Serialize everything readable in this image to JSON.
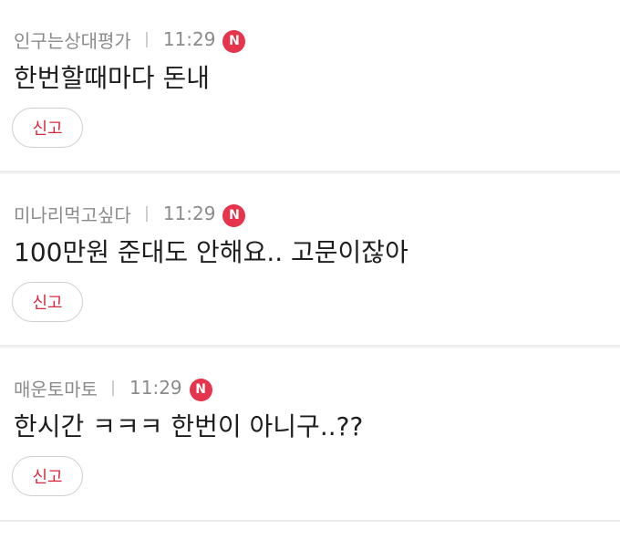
{
  "comments": [
    {
      "nickname": "인구는상대평가",
      "time": "11:29",
      "badge": "N",
      "text": "한번할때마다 돈내",
      "report_label": "신고"
    },
    {
      "nickname": "미나리먹고싶다",
      "time": "11:29",
      "badge": "N",
      "text": "100만원 준대도 안해요.. 고문이잖아",
      "report_label": "신고"
    },
    {
      "nickname": "매운토마토",
      "time": "11:29",
      "badge": "N",
      "text": "한시간 ㅋㅋㅋ 한번이 아니구..??",
      "report_label": "신고"
    }
  ],
  "colors": {
    "badge_bg": "#e5344b",
    "report_text": "#d8283f",
    "meta_text": "#8b8b8b",
    "body_text": "#1e1e1e"
  }
}
